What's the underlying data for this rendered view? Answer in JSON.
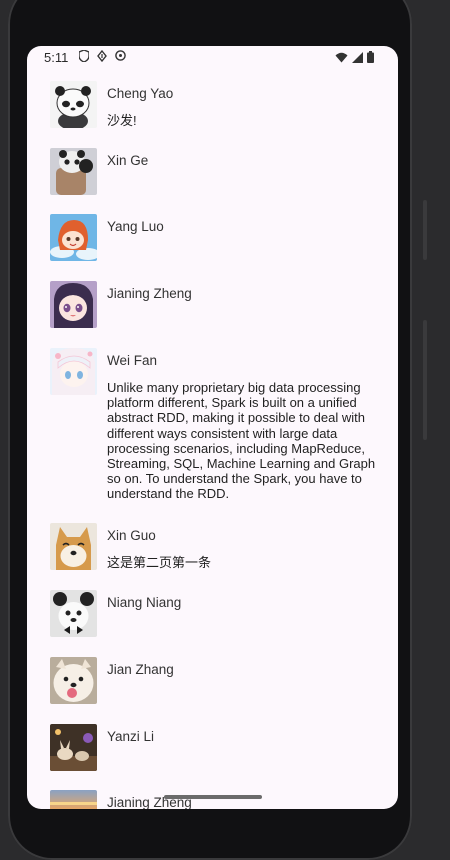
{
  "status": {
    "time": "5:11"
  },
  "posts": [
    {
      "name": "Cheng Yao",
      "text": "沙发!"
    },
    {
      "name": "Xin Ge",
      "text": ""
    },
    {
      "name": "Yang Luo",
      "text": ""
    },
    {
      "name": "Jianing Zheng",
      "text": ""
    },
    {
      "name": "Wei Fan",
      "text": "Unlike many proprietary big data processing platform different, Spark is built on a unified abstract RDD, making it possible to deal with different ways consistent with large data processing scenarios, including MapReduce, Streaming, SQL, Machine Learning and Graph so on. To understand the Spark, you have to understand the RDD."
    },
    {
      "name": "Xin Guo",
      "text": "这是第二页第一条"
    },
    {
      "name": "Niang Niang",
      "text": ""
    },
    {
      "name": "Jian Zhang",
      "text": ""
    },
    {
      "name": "Yanzi Li",
      "text": ""
    },
    {
      "name": "Jianing Zheng",
      "text": ""
    }
  ]
}
